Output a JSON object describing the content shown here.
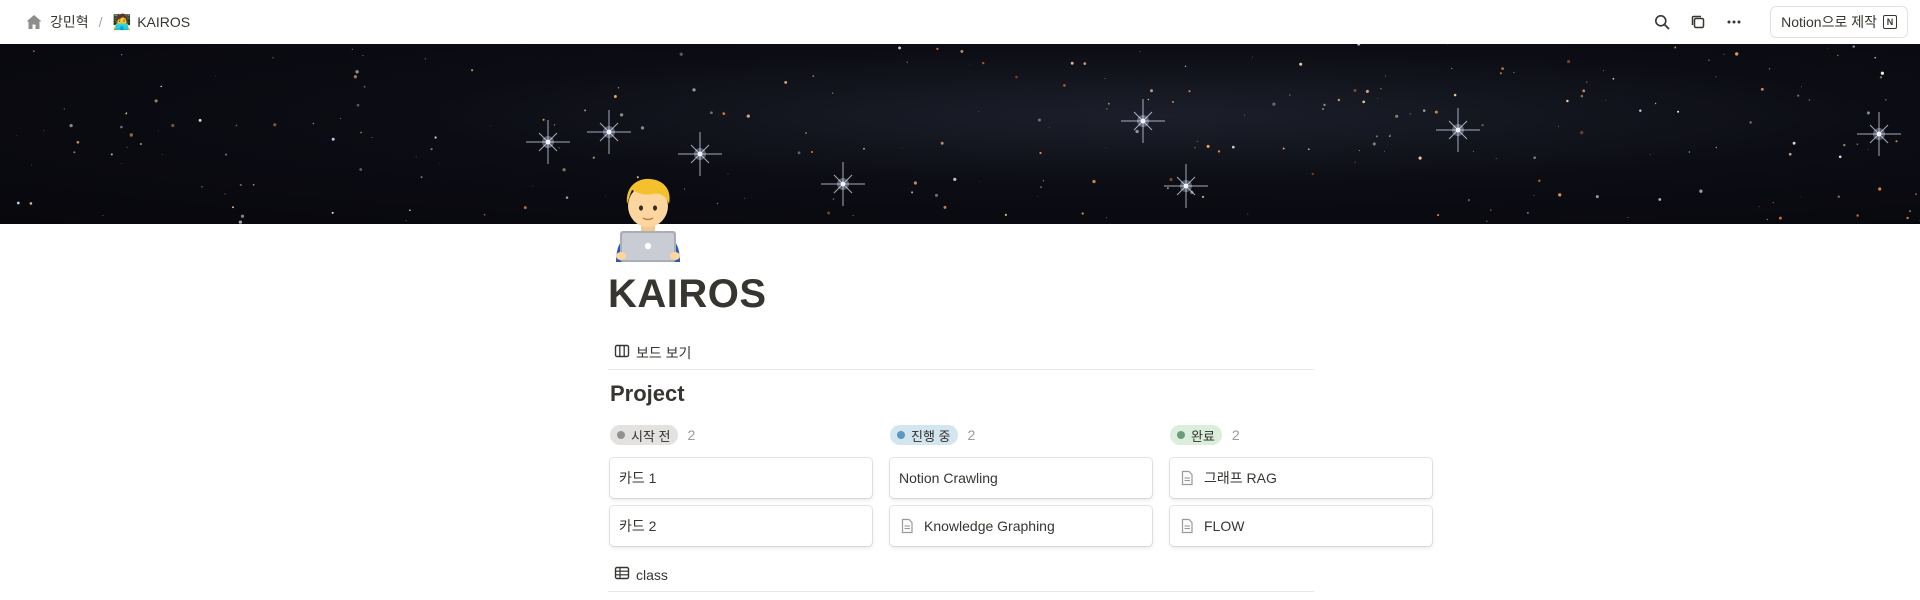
{
  "breadcrumb": {
    "workspace": "강민혁",
    "separator": "/",
    "page_emoji": "🧑‍💻",
    "page": "KAIROS"
  },
  "topbar": {
    "icons": [
      "search-icon",
      "duplicate-icon",
      "more-icon"
    ],
    "notion_button": "Notion으로 제작",
    "notion_logo": "N"
  },
  "cover": {
    "description_icon": "space-galaxy-cover"
  },
  "page": {
    "icon": "🧑‍💻",
    "title": "KAIROS"
  },
  "view_tab": {
    "label": "보드 보기",
    "icon": "board-icon"
  },
  "database": {
    "title": "Project"
  },
  "board": {
    "columns": [
      {
        "status": "시작 전",
        "count": "2",
        "pill_bg": "#e3e2e0",
        "dot": "#91918e",
        "cards": [
          {
            "title": "카드 1",
            "has_doc_icon": false
          },
          {
            "title": "카드 2",
            "has_doc_icon": false
          }
        ]
      },
      {
        "status": "진행 중",
        "count": "2",
        "pill_bg": "#d3e5ef",
        "dot": "#5b97bd",
        "cards": [
          {
            "title": "Notion Crawling",
            "has_doc_icon": false
          },
          {
            "title": "Knowledge Graphing",
            "has_doc_icon": true
          }
        ]
      },
      {
        "status": "완료",
        "count": "2",
        "pill_bg": "#dbeddb",
        "dot": "#6c9b7d",
        "cards": [
          {
            "title": "그래프 RAG",
            "has_doc_icon": true
          },
          {
            "title": "FLOW",
            "has_doc_icon": true
          }
        ]
      }
    ]
  },
  "second_view": {
    "label": "class",
    "icon": "table-icon"
  }
}
